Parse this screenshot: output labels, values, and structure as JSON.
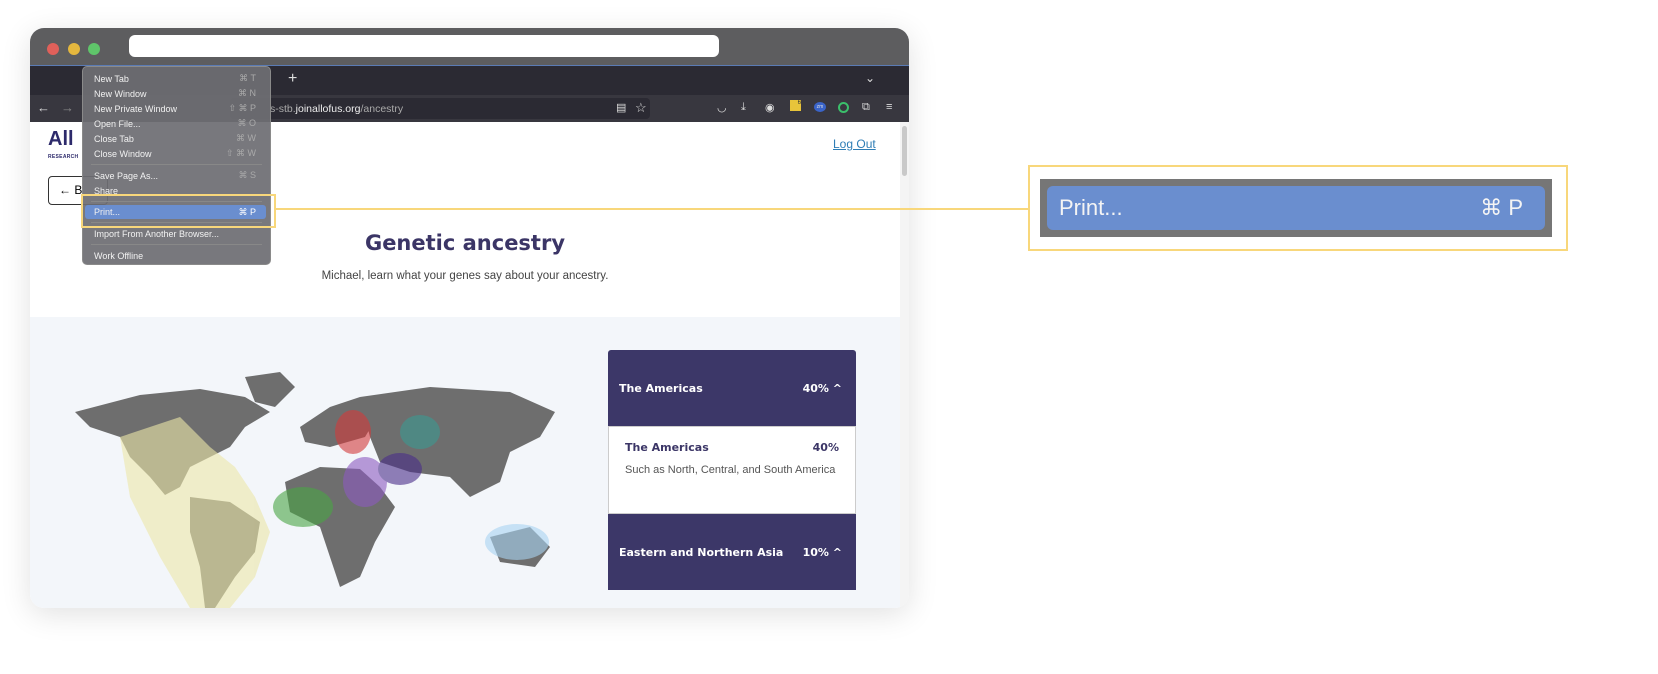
{
  "browser": {
    "url_domain_prefix": "s-stb.",
    "url_domain": "joinallofus.org",
    "url_path": "/ancestry",
    "new_tab": "+",
    "tab_list": "⌄",
    "back": "←",
    "forward": "→",
    "extension_badge": "6",
    "zoom_ext": "zm"
  },
  "menu": {
    "items": [
      {
        "label": "New Tab",
        "shortcut": "⌘ T"
      },
      {
        "label": "New Window",
        "shortcut": "⌘ N"
      },
      {
        "label": "New Private Window",
        "shortcut": "⇧ ⌘ P"
      },
      {
        "label": "Open File...",
        "shortcut": "⌘ O"
      },
      {
        "label": "Close Tab",
        "shortcut": "⌘ W"
      },
      {
        "label": "Close Window",
        "shortcut": "⇧ ⌘ W"
      },
      {
        "label": "Save Page As...",
        "shortcut": "⌘ S"
      },
      {
        "label": "Share",
        "shortcut": ""
      },
      {
        "label": "Print...",
        "shortcut": "⌘ P"
      },
      {
        "label": "Import From Another Browser...",
        "shortcut": ""
      },
      {
        "label": "Work Offline",
        "shortcut": ""
      }
    ],
    "selected": "Print..."
  },
  "page": {
    "logo": "All",
    "logo_sub": "RESEARCH",
    "logout": "Log Out",
    "back": "B",
    "title": "Genetic ancestry",
    "subtitle": "Michael, learn what your genes say about your ancestry."
  },
  "panel": {
    "sections": [
      {
        "label": "The Americas",
        "percent": "40%",
        "expanded": true,
        "detail_title": "The Americas",
        "detail_percent": "40%",
        "description": "Such as North, Central, and South America"
      },
      {
        "label": "Eastern and Northern Asia",
        "percent": "10%"
      }
    ],
    "chevron": "^"
  },
  "callout": {
    "label": "Print...",
    "shortcut": "⌘ P"
  },
  "colors": {
    "accent": "#3c3768",
    "highlight": "#f8d77b",
    "menu_selected": "#6a8ecf",
    "link": "#2e7db5"
  }
}
